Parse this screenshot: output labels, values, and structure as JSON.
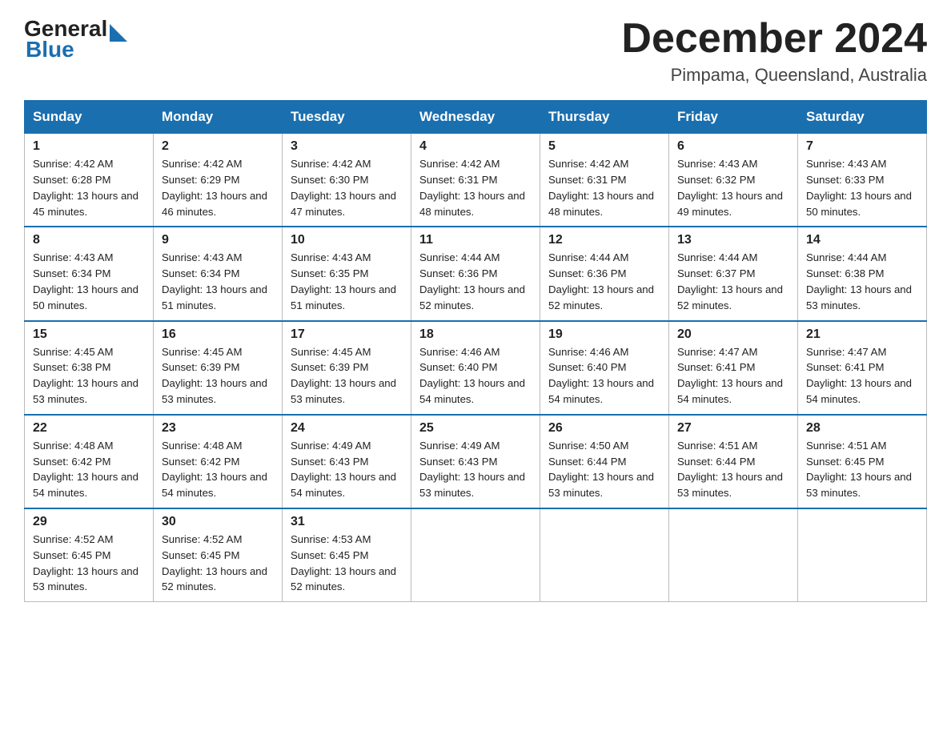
{
  "header": {
    "logo_general": "General",
    "logo_blue": "Blue",
    "month_title": "December 2024",
    "location": "Pimpama, Queensland, Australia"
  },
  "calendar": {
    "days_of_week": [
      "Sunday",
      "Monday",
      "Tuesday",
      "Wednesday",
      "Thursday",
      "Friday",
      "Saturday"
    ],
    "weeks": [
      [
        {
          "num": "1",
          "sunrise": "4:42 AM",
          "sunset": "6:28 PM",
          "daylight": "13 hours and 45 minutes."
        },
        {
          "num": "2",
          "sunrise": "4:42 AM",
          "sunset": "6:29 PM",
          "daylight": "13 hours and 46 minutes."
        },
        {
          "num": "3",
          "sunrise": "4:42 AM",
          "sunset": "6:30 PM",
          "daylight": "13 hours and 47 minutes."
        },
        {
          "num": "4",
          "sunrise": "4:42 AM",
          "sunset": "6:31 PM",
          "daylight": "13 hours and 48 minutes."
        },
        {
          "num": "5",
          "sunrise": "4:42 AM",
          "sunset": "6:31 PM",
          "daylight": "13 hours and 48 minutes."
        },
        {
          "num": "6",
          "sunrise": "4:43 AM",
          "sunset": "6:32 PM",
          "daylight": "13 hours and 49 minutes."
        },
        {
          "num": "7",
          "sunrise": "4:43 AM",
          "sunset": "6:33 PM",
          "daylight": "13 hours and 50 minutes."
        }
      ],
      [
        {
          "num": "8",
          "sunrise": "4:43 AM",
          "sunset": "6:34 PM",
          "daylight": "13 hours and 50 minutes."
        },
        {
          "num": "9",
          "sunrise": "4:43 AM",
          "sunset": "6:34 PM",
          "daylight": "13 hours and 51 minutes."
        },
        {
          "num": "10",
          "sunrise": "4:43 AM",
          "sunset": "6:35 PM",
          "daylight": "13 hours and 51 minutes."
        },
        {
          "num": "11",
          "sunrise": "4:44 AM",
          "sunset": "6:36 PM",
          "daylight": "13 hours and 52 minutes."
        },
        {
          "num": "12",
          "sunrise": "4:44 AM",
          "sunset": "6:36 PM",
          "daylight": "13 hours and 52 minutes."
        },
        {
          "num": "13",
          "sunrise": "4:44 AM",
          "sunset": "6:37 PM",
          "daylight": "13 hours and 52 minutes."
        },
        {
          "num": "14",
          "sunrise": "4:44 AM",
          "sunset": "6:38 PM",
          "daylight": "13 hours and 53 minutes."
        }
      ],
      [
        {
          "num": "15",
          "sunrise": "4:45 AM",
          "sunset": "6:38 PM",
          "daylight": "13 hours and 53 minutes."
        },
        {
          "num": "16",
          "sunrise": "4:45 AM",
          "sunset": "6:39 PM",
          "daylight": "13 hours and 53 minutes."
        },
        {
          "num": "17",
          "sunrise": "4:45 AM",
          "sunset": "6:39 PM",
          "daylight": "13 hours and 53 minutes."
        },
        {
          "num": "18",
          "sunrise": "4:46 AM",
          "sunset": "6:40 PM",
          "daylight": "13 hours and 54 minutes."
        },
        {
          "num": "19",
          "sunrise": "4:46 AM",
          "sunset": "6:40 PM",
          "daylight": "13 hours and 54 minutes."
        },
        {
          "num": "20",
          "sunrise": "4:47 AM",
          "sunset": "6:41 PM",
          "daylight": "13 hours and 54 minutes."
        },
        {
          "num": "21",
          "sunrise": "4:47 AM",
          "sunset": "6:41 PM",
          "daylight": "13 hours and 54 minutes."
        }
      ],
      [
        {
          "num": "22",
          "sunrise": "4:48 AM",
          "sunset": "6:42 PM",
          "daylight": "13 hours and 54 minutes."
        },
        {
          "num": "23",
          "sunrise": "4:48 AM",
          "sunset": "6:42 PM",
          "daylight": "13 hours and 54 minutes."
        },
        {
          "num": "24",
          "sunrise": "4:49 AM",
          "sunset": "6:43 PM",
          "daylight": "13 hours and 54 minutes."
        },
        {
          "num": "25",
          "sunrise": "4:49 AM",
          "sunset": "6:43 PM",
          "daylight": "13 hours and 53 minutes."
        },
        {
          "num": "26",
          "sunrise": "4:50 AM",
          "sunset": "6:44 PM",
          "daylight": "13 hours and 53 minutes."
        },
        {
          "num": "27",
          "sunrise": "4:51 AM",
          "sunset": "6:44 PM",
          "daylight": "13 hours and 53 minutes."
        },
        {
          "num": "28",
          "sunrise": "4:51 AM",
          "sunset": "6:45 PM",
          "daylight": "13 hours and 53 minutes."
        }
      ],
      [
        {
          "num": "29",
          "sunrise": "4:52 AM",
          "sunset": "6:45 PM",
          "daylight": "13 hours and 53 minutes."
        },
        {
          "num": "30",
          "sunrise": "4:52 AM",
          "sunset": "6:45 PM",
          "daylight": "13 hours and 52 minutes."
        },
        {
          "num": "31",
          "sunrise": "4:53 AM",
          "sunset": "6:45 PM",
          "daylight": "13 hours and 52 minutes."
        },
        null,
        null,
        null,
        null
      ]
    ]
  }
}
